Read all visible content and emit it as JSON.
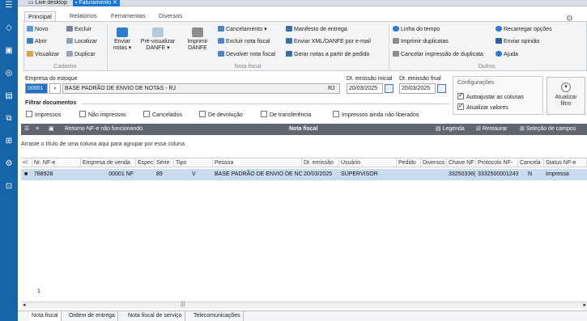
{
  "window": {
    "tab_home": "Live desktop",
    "tab_active": "Faturamento",
    "tab_close": "✕"
  },
  "ribbon_tabs": [
    "Principal",
    "Relatórios",
    "Ferramentas",
    "Diversos"
  ],
  "ribbon": {
    "cadastro": {
      "novo": "Novo",
      "excluir": "Excluir",
      "abrir": "Abrir",
      "localizar": "Localizar",
      "visualizar": "Visualizar",
      "duplicar": "Duplicar",
      "group": "Cadastro"
    },
    "nota_fiscal": {
      "enviar": [
        "Enviar",
        "notas ▾"
      ],
      "pre_visualizar": [
        "Pré-visualizar",
        "DANFE ▾"
      ],
      "imprimir": [
        "Imprimir",
        "DANFE"
      ],
      "cancelamento": "Cancelamento ▾",
      "excluir_nota": "Excluir nota fiscal",
      "devolver": "Devolver nota fiscal",
      "manifesto": "Manifesto de entrega",
      "enviar_xml": "Enviar XML/DANFE por e-mail",
      "gerar": "Gerar notas a partir de pedido",
      "group": "Nota fiscal"
    },
    "outros": {
      "linha_tempo": "Linha do tempo",
      "imprimir_dup": "Imprimir duplicatas",
      "cancelar_imp": "Cancelar impressão de duplicata",
      "recarregar": "Recarregar opções",
      "enviar_opiniao": "Enviar opinião",
      "ajuda": "Ajuda",
      "group": "Outros"
    }
  },
  "filters": {
    "empresa_label": "Empresa do estoque",
    "empresa_code": "00001",
    "empresa_name": "BASE PADRÃO DE ENVIO DE NOTAS - RJ",
    "empresa_uf": "RJ",
    "dt_inicial_label": "Dt. emissão inicial",
    "dt_inicial": "20/03/2025",
    "dt_final_label": "Dt. emissão final",
    "dt_final": "20/03/2025",
    "filtrar_label": "Filtrar documentos",
    "options": [
      "Impressos",
      "Não impressos",
      "Cancelados",
      "De devolução",
      "De transferência",
      "Impressos ainda não liberados"
    ]
  },
  "config": {
    "title": "Configurações",
    "auto_ajustar": "Autoajustar as colunas",
    "atualizar_valores": "Atualizar valores"
  },
  "refresh": {
    "label1": "Atualizar",
    "label2": "filtro"
  },
  "grid": {
    "status_text": "Retorno NF-e não funcionando.",
    "title": "Nota fiscal",
    "legenda": "Legenda",
    "restaurar": "Restaurar",
    "selecao": "Seleção de campos",
    "group_hint": "Arraste o título de uma coluna aqui para agrupar por essa coluna",
    "columns": [
      "<!",
      "Nr. NF-e",
      "Empresa de venda",
      "Especi",
      "Série",
      "Tipo",
      "Pessoa",
      "Dt. emissão",
      "Usuário",
      "Pedido",
      "Diversos",
      "Chave NF",
      "Protocolo NF-",
      "Cancela",
      "Status NF-e"
    ],
    "row": [
      "■",
      "788928",
      "00001 NF",
      "",
      "89",
      "V",
      "BASE PADRÃO DE ENVIO DE NO",
      "20/03/2025",
      "SUPERVISOR",
      "",
      "",
      "33250336(",
      "3332500001243",
      "N",
      "Impressa"
    ],
    "count": "1"
  },
  "bottom_tabs": [
    "Nota fiscal",
    "Ordem de entrega",
    "Nota fiscal de serviço",
    "Telecomunicações"
  ]
}
